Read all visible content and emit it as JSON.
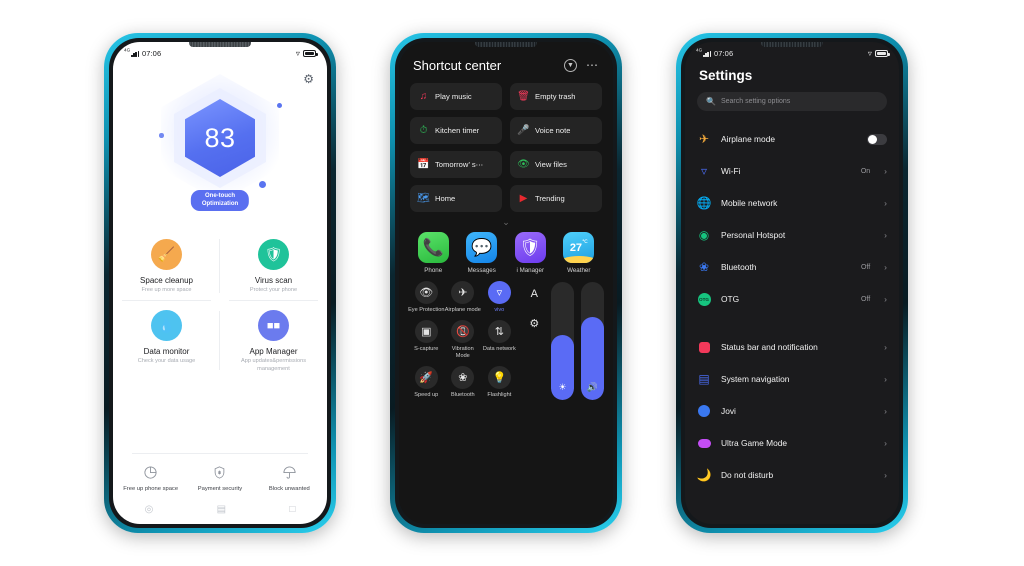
{
  "phone1": {
    "status": {
      "network": "4G",
      "time": "07:06"
    },
    "gear_icon": "gear-icon",
    "score": "83",
    "optimize_button": {
      "line1": "One-touch",
      "line2": "Optimization"
    },
    "features": [
      {
        "title": "Space cleanup",
        "subtitle": "Free up more space",
        "icon": "broom-icon",
        "color": "#F5A94E"
      },
      {
        "title": "Virus scan",
        "subtitle": "Protect your phone",
        "icon": "shield-icon",
        "color": "#1FC39A"
      },
      {
        "title": "Data monitor",
        "subtitle": "Check your data usage",
        "icon": "droplet-icon",
        "color": "#4EC3F0"
      },
      {
        "title": "App Manager",
        "subtitle": "App updates&permissions management",
        "icon": "apps-grid-icon",
        "color": "#6B7BEE"
      }
    ],
    "tools": [
      {
        "label": "Free up phone space",
        "icon": "pie-chart-icon"
      },
      {
        "label": "Payment security",
        "icon": "payment-shield-icon"
      },
      {
        "label": "Block unwanted",
        "icon": "umbrella-icon"
      }
    ],
    "nav": [
      {
        "icon": "location-icon"
      },
      {
        "icon": "manager-icon"
      },
      {
        "icon": "tools-icon"
      }
    ]
  },
  "phone2": {
    "title": "Shortcut center",
    "header_icons": [
      "chevron-down-circle-icon",
      "more-options-icon"
    ],
    "tiles": [
      {
        "label": "Play music",
        "icon": "music-note-icon",
        "color": "#F2395A"
      },
      {
        "label": "Empty trash",
        "icon": "trash-icon",
        "color": "#F2395A"
      },
      {
        "label": "Kitchen timer",
        "icon": "timer-icon",
        "color": "#2FBF5A"
      },
      {
        "label": "Voice note",
        "icon": "microphone-icon",
        "color": "#4A7BF0"
      },
      {
        "label": "Tomorrow’ s⋯",
        "icon": "calendar-icon",
        "color": "#F2395A"
      },
      {
        "label": "View files",
        "icon": "files-eye-icon",
        "color": "#2FBF5A"
      },
      {
        "label": "Home",
        "icon": "maps-icon",
        "color": "#4A9BF0"
      },
      {
        "label": "Trending",
        "icon": "youtube-icon",
        "color": "#E8292F"
      }
    ],
    "expand_icon": "chevron-down-icon",
    "apps": [
      {
        "label": "Phone",
        "icon": "phone-icon",
        "color": "#3ECB4C"
      },
      {
        "label": "Messages",
        "icon": "messages-icon",
        "color": "#2196F3"
      },
      {
        "label": "i Manager",
        "icon": "imanager-shield-icon",
        "color": "#7C4DF5"
      },
      {
        "label": "Weather",
        "icon": "weather-icon",
        "color": "#29B6F6",
        "temp": "27",
        "unit": "℃"
      }
    ],
    "toggles": [
      {
        "label": "Eye Protection",
        "icon": "eye-icon",
        "on": false
      },
      {
        "label": "Airplane mode",
        "icon": "airplane-icon",
        "on": false
      },
      {
        "label": "vivo",
        "icon": "wifi-icon",
        "on": true
      },
      {
        "label": "S-capture",
        "icon": "screenshot-icon",
        "on": false
      },
      {
        "label": "Vibration Mode",
        "icon": "vibration-icon",
        "on": false
      },
      {
        "label": "Data network",
        "icon": "data-network-icon",
        "on": false
      },
      {
        "label": "Speed up",
        "icon": "rocket-icon",
        "on": false
      },
      {
        "label": "Bluetooth",
        "icon": "bluetooth-icon",
        "on": false
      },
      {
        "label": "Flashlight",
        "icon": "flashlight-icon",
        "on": false
      }
    ],
    "extra_icons": [
      {
        "name": "auto-brightness-icon",
        "glyph": "A"
      },
      {
        "name": "settings-gear-icon",
        "glyph": "⚙"
      }
    ],
    "sliders": [
      {
        "name": "brightness-slider",
        "icon": "brightness-icon",
        "percent": 55
      },
      {
        "name": "volume-slider",
        "icon": "volume-icon",
        "percent": 70
      }
    ],
    "accent": "#5A6BF5"
  },
  "phone3": {
    "status": {
      "network": "4G",
      "time": "07:06"
    },
    "title": "Settings",
    "search_placeholder": "Search setting options",
    "search_icon": "search-icon",
    "group1": [
      {
        "label": "Airplane mode",
        "icon": "airplane-icon",
        "color": "#F2A93B",
        "control": "switch",
        "value": ""
      },
      {
        "label": "Wi-Fi",
        "icon": "wifi-icon",
        "color": "#4A6BF0",
        "control": "chevron",
        "value": "On"
      },
      {
        "label": "Mobile network",
        "icon": "globe-icon",
        "color": "#16C47F",
        "control": "chevron",
        "value": ""
      },
      {
        "label": "Personal Hotspot",
        "icon": "hotspot-icon",
        "color": "#16C47F",
        "control": "chevron",
        "value": ""
      },
      {
        "label": "Bluetooth",
        "icon": "bluetooth-icon",
        "color": "#3A78F0",
        "control": "chevron",
        "value": "Off"
      },
      {
        "label": "OTG",
        "icon": "otg-icon",
        "color": "#16C47F",
        "control": "chevron",
        "value": "Off"
      }
    ],
    "group2": [
      {
        "label": "Status bar and notification",
        "icon": "notification-icon",
        "color": "#F2395A",
        "control": "chevron",
        "value": ""
      },
      {
        "label": "System navigation",
        "icon": "navigation-icon",
        "color": "#4A6BF0",
        "control": "chevron",
        "value": ""
      },
      {
        "label": "Jovi",
        "icon": "jovi-icon",
        "color": "#3A78F0",
        "control": "chevron",
        "value": ""
      },
      {
        "label": "Ultra Game Mode",
        "icon": "gamepad-icon",
        "color": "#C44DF5",
        "control": "chevron",
        "value": ""
      },
      {
        "label": "Do not disturb",
        "icon": "moon-icon",
        "color": "#B07BF5",
        "control": "chevron",
        "value": ""
      }
    ]
  }
}
